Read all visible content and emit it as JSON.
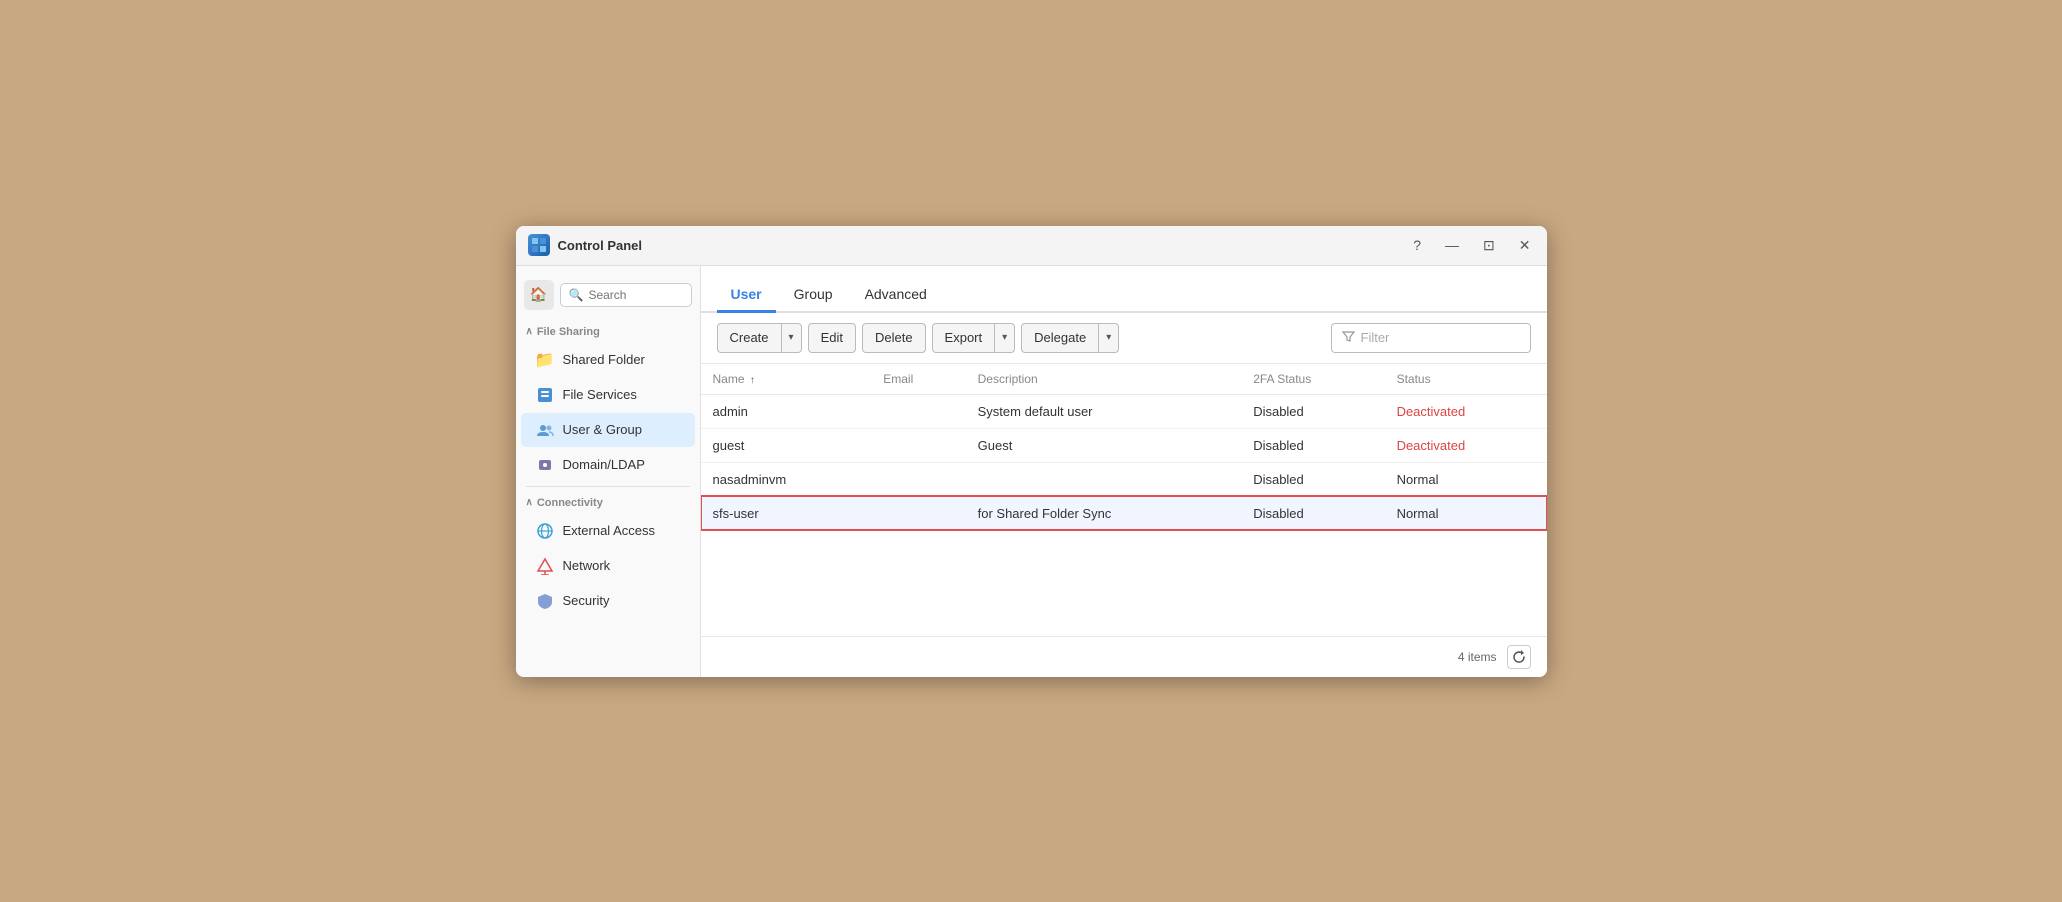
{
  "window": {
    "title": "Control Panel",
    "icon": "⊞"
  },
  "titlebar_controls": {
    "help": "?",
    "minimize": "—",
    "restore": "⊡",
    "close": "✕"
  },
  "sidebar": {
    "search_placeholder": "Search",
    "sections": [
      {
        "name": "File Sharing",
        "collapsed": false,
        "items": [
          {
            "id": "shared-folder",
            "label": "Shared Folder",
            "icon": "📁",
            "iconClass": "icon-folder"
          },
          {
            "id": "file-services",
            "label": "File Services",
            "icon": "🔄",
            "iconClass": "icon-file-services"
          },
          {
            "id": "user-group",
            "label": "User & Group",
            "icon": "👥",
            "iconClass": "icon-user-group",
            "active": true
          },
          {
            "id": "domain-ldap",
            "label": "Domain/LDAP",
            "icon": "👤",
            "iconClass": "icon-domain"
          }
        ]
      },
      {
        "name": "Connectivity",
        "collapsed": false,
        "items": [
          {
            "id": "external-access",
            "label": "External Access",
            "icon": "🌐",
            "iconClass": "icon-external-access"
          },
          {
            "id": "network",
            "label": "Network",
            "icon": "🏠",
            "iconClass": "icon-network"
          },
          {
            "id": "security",
            "label": "Security",
            "icon": "🔒",
            "iconClass": "icon-security"
          }
        ]
      }
    ]
  },
  "tabs": [
    {
      "id": "user",
      "label": "User",
      "active": true
    },
    {
      "id": "group",
      "label": "Group",
      "active": false
    },
    {
      "id": "advanced",
      "label": "Advanced",
      "active": false
    }
  ],
  "toolbar": {
    "create_label": "Create",
    "edit_label": "Edit",
    "delete_label": "Delete",
    "export_label": "Export",
    "delegate_label": "Delegate",
    "filter_placeholder": "Filter"
  },
  "table": {
    "columns": [
      {
        "id": "name",
        "label": "Name",
        "sortable": true,
        "sort_arrow": "↑"
      },
      {
        "id": "email",
        "label": "Email",
        "sortable": false
      },
      {
        "id": "description",
        "label": "Description",
        "sortable": false
      },
      {
        "id": "2fa_status",
        "label": "2FA Status",
        "sortable": false
      },
      {
        "id": "status",
        "label": "Status",
        "sortable": false
      }
    ],
    "rows": [
      {
        "name": "admin",
        "email": "",
        "description": "System default user",
        "2fa_status": "Disabled",
        "status": "Deactivated",
        "status_class": "deactivated",
        "highlighted": false
      },
      {
        "name": "guest",
        "email": "",
        "description": "Guest",
        "2fa_status": "Disabled",
        "status": "Deactivated",
        "status_class": "deactivated",
        "highlighted": false
      },
      {
        "name": "nasadminvm",
        "email": "",
        "description": "",
        "2fa_status": "Disabled",
        "status": "Normal",
        "status_class": "normal",
        "highlighted": false
      },
      {
        "name": "sfs-user",
        "email": "",
        "description": "for Shared Folder Sync",
        "2fa_status": "Disabled",
        "status": "Normal",
        "status_class": "normal",
        "highlighted": true
      }
    ]
  },
  "footer": {
    "items_count": "4 items"
  }
}
